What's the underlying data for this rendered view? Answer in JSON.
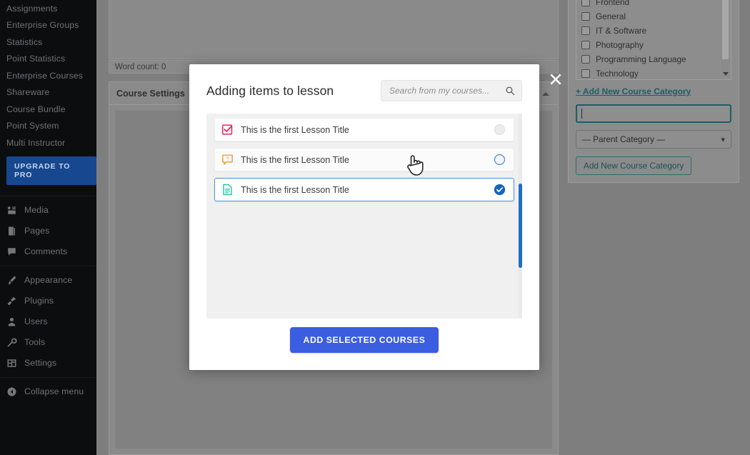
{
  "sidebar": {
    "menu_items": [
      {
        "label": "Assignments",
        "icon": "none"
      },
      {
        "label": "Enterprise Groups",
        "icon": "none"
      },
      {
        "label": "Statistics",
        "icon": "none"
      },
      {
        "label": "Point Statistics",
        "icon": "none"
      },
      {
        "label": "Enterprise Courses",
        "icon": "none"
      },
      {
        "label": "Shareware",
        "icon": "none"
      },
      {
        "label": "Course Bundle",
        "icon": "none"
      },
      {
        "label": "Point System",
        "icon": "none"
      },
      {
        "label": "Multi Instructor",
        "icon": "none"
      }
    ],
    "upgrade_label": "UPGRADE TO PRO",
    "icon_items": [
      {
        "label": "Media",
        "icon": "media-icon"
      },
      {
        "label": "Pages",
        "icon": "pages-icon"
      },
      {
        "label": "Comments",
        "icon": "comments-icon"
      }
    ],
    "icon_items_2": [
      {
        "label": "Appearance",
        "icon": "appearance-brush-icon"
      },
      {
        "label": "Plugins",
        "icon": "plugins-plug-icon"
      },
      {
        "label": "Users",
        "icon": "users-person-icon"
      },
      {
        "label": "Tools",
        "icon": "tools-wrench-icon"
      },
      {
        "label": "Settings",
        "icon": "settings-sliders-icon"
      }
    ],
    "collapse": {
      "label": "Collapse menu",
      "icon": "collapse-arrow-icon"
    }
  },
  "editor": {
    "word_count": "Word count: 0"
  },
  "settings_panel": {
    "title": "Course Settings",
    "toggle_icon": "caret-up-icon"
  },
  "category_box": {
    "items": [
      {
        "label": "Frontend",
        "checked": false
      },
      {
        "label": "General",
        "checked": false
      },
      {
        "label": "IT & Software",
        "checked": false
      },
      {
        "label": "Photography",
        "checked": false
      },
      {
        "label": "Programming Language",
        "checked": false
      },
      {
        "label": "Technology",
        "checked": false
      }
    ],
    "add_link": "+ Add New Course Category",
    "new_category_value": "",
    "parent_select_value": "— Parent Category —",
    "add_button": "Add New Course Category",
    "scroll_down_icon": "caret-down-icon"
  },
  "modal": {
    "title": "Adding items to lesson",
    "close_icon": "close-x-icon",
    "search": {
      "placeholder": "Search from my courses...",
      "value": "",
      "icon": "search-icon"
    },
    "items": [
      {
        "title": "This is the first Lesson Title",
        "icon": "assignment-checkbox-icon",
        "icon_color": "#e8245c",
        "state": "unselected",
        "hovered": false
      },
      {
        "title": "This is the first Lesson Title",
        "icon": "quiz-question-bubble-icon",
        "icon_color": "#f0a030",
        "state": "hover",
        "hovered": true
      },
      {
        "title": "This is the first Lesson Title",
        "icon": "lesson-document-icon",
        "icon_color": "#2ec4a6",
        "state": "selected",
        "hovered": false
      }
    ],
    "submit_label": "ADD SELECTED COURSES",
    "scrollbar_color": "#1f6fc4"
  },
  "cursor": {
    "icon": "pointing-hand-cursor"
  },
  "colors": {
    "primary_button": "#3b5ee0",
    "selected_blue": "#1f6fc4",
    "sidebar_bg": "#0b0d0f",
    "upgrade_bg": "#17478f",
    "overlay_grey": "#7e7e7e"
  }
}
